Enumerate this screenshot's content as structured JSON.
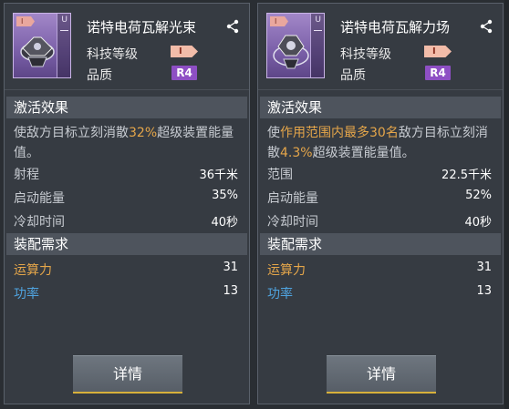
{
  "panels": [
    {
      "title": "诺特电荷瓦解光束",
      "thumb": {
        "tag": "I",
        "u": "U"
      },
      "tech_level_label": "科技等级",
      "tech_level_badge": "I",
      "quality_label": "品质",
      "quality_badge": "R4",
      "activation_header": "激活效果",
      "description": {
        "pre": "使敌方目标立刻消散",
        "hl1": "32%",
        "mid": "",
        "hl2": "",
        "post": "超级装置能量值。"
      },
      "stats": [
        {
          "label": "射程",
          "value": "36千米"
        },
        {
          "label": "启动能量",
          "value": "35%"
        },
        {
          "label": "冷却时间",
          "value": "40秒"
        }
      ],
      "requirements_header": "装配需求",
      "requirements": [
        {
          "label": "运算力",
          "value": "31",
          "color": "#e5a64a"
        },
        {
          "label": "功率",
          "value": "13",
          "color": "#4fa3df"
        }
      ],
      "detail_button": "详情"
    },
    {
      "title": "诺特电荷瓦解力场",
      "thumb": {
        "tag": "I",
        "u": "U"
      },
      "tech_level_label": "科技等级",
      "tech_level_badge": "I",
      "quality_label": "品质",
      "quality_badge": "R4",
      "activation_header": "激活效果",
      "description": {
        "pre": "使",
        "hl1": "作用范围内最多30名",
        "mid": "敌方目标立刻消散",
        "hl2": "4.3%",
        "post": "超级装置能量值。"
      },
      "stats": [
        {
          "label": "范围",
          "value": "22.5千米"
        },
        {
          "label": "启动能量",
          "value": "52%"
        },
        {
          "label": "冷却时间",
          "value": "40秒"
        }
      ],
      "requirements_header": "装配需求",
      "requirements": [
        {
          "label": "运算力",
          "value": "31",
          "color": "#e5a64a"
        },
        {
          "label": "功率",
          "value": "13",
          "color": "#4fa3df"
        }
      ],
      "detail_button": "详情"
    }
  ],
  "icons": {
    "share": "share-icon",
    "item": "module-icon"
  },
  "colors": {
    "accent_gold": "#d7b13b",
    "quality_purple": "#8e4fc4",
    "highlight_orange": "#e5a64a",
    "power_blue": "#4fa3df"
  }
}
